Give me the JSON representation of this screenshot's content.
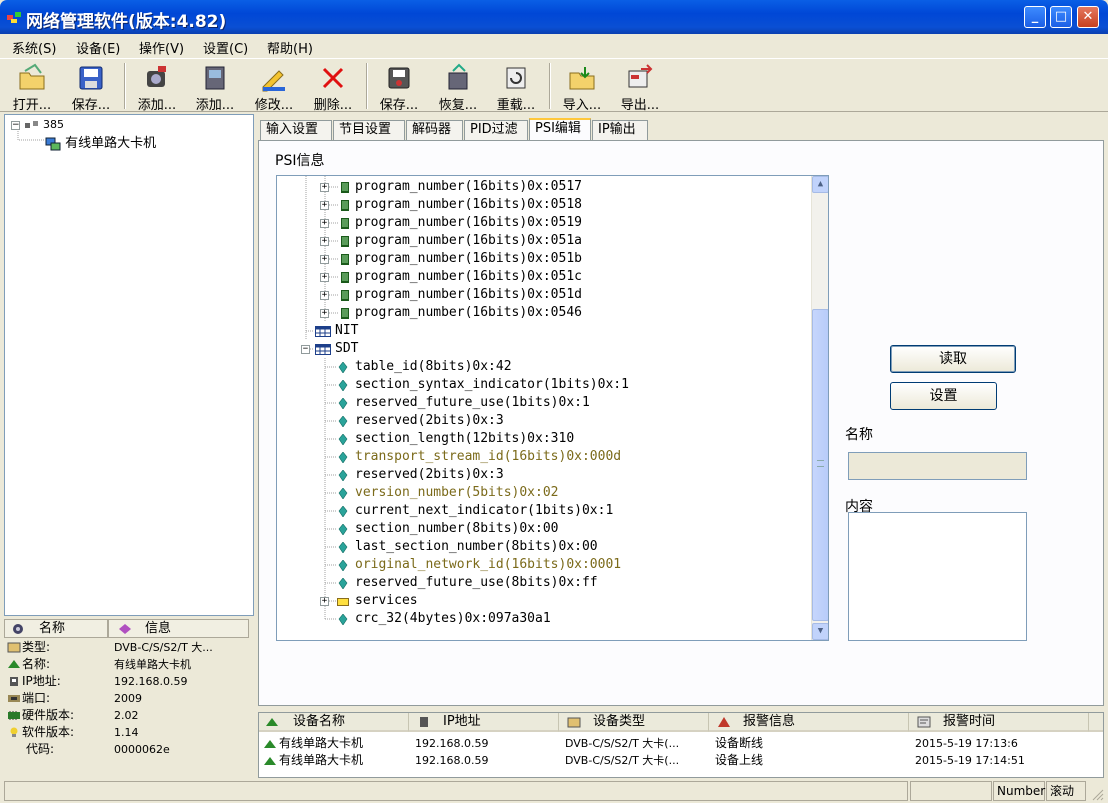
{
  "window": {
    "title": "网络管理软件(版本:4.82)",
    "minimize": "_",
    "maximize": "□",
    "close": "✕"
  },
  "menu": [
    {
      "label": "系统(S)"
    },
    {
      "label": "设备(E)"
    },
    {
      "label": "操作(V)"
    },
    {
      "label": "设置(C)"
    },
    {
      "label": "帮助(H)"
    }
  ],
  "toolbar": {
    "buttons": [
      {
        "label": "打开...",
        "icon": "open-folder-icon"
      },
      {
        "label": "保存...",
        "icon": "save-disk-icon"
      },
      {
        "label": "添加...",
        "icon": "add-camera-icon"
      },
      {
        "label": "添加...",
        "icon": "add-device-icon"
      },
      {
        "label": "修改...",
        "icon": "edit-icon"
      },
      {
        "label": "删除...",
        "icon": "delete-icon"
      },
      {
        "label": "保存...",
        "icon": "save-config-icon"
      },
      {
        "label": "恢复...",
        "icon": "restore-icon"
      },
      {
        "label": "重载...",
        "icon": "reload-icon"
      },
      {
        "label": "导入...",
        "icon": "import-icon"
      },
      {
        "label": "导出...",
        "icon": "export-icon"
      }
    ]
  },
  "device_tree": {
    "root": "385",
    "child": "有线单路大卡机"
  },
  "info_panel": {
    "headers": {
      "name": "名称",
      "info": "信息"
    },
    "rows": [
      {
        "key": "类型:",
        "value": "DVB-C/S/S2/T 大...",
        "icon": "type-icon"
      },
      {
        "key": "名称:",
        "value": "有线单路大卡机",
        "icon": "name-icon"
      },
      {
        "key": "IP地址:",
        "value": "192.168.0.59",
        "icon": "ip-icon"
      },
      {
        "key": "端口:",
        "value": "2009",
        "icon": "port-icon"
      },
      {
        "key": "硬件版本:",
        "value": "2.02",
        "icon": "hardware-icon"
      },
      {
        "key": "软件版本:",
        "value": "1.14",
        "icon": "software-icon"
      },
      {
        "key": "代码:",
        "value": "0000062e",
        "icon": ""
      }
    ]
  },
  "tabs": [
    {
      "label": "输入设置"
    },
    {
      "label": "节目设置"
    },
    {
      "label": "解码器"
    },
    {
      "label": "PID过滤"
    },
    {
      "label": "PSI编辑",
      "active": true
    },
    {
      "label": "IP输出"
    }
  ],
  "psi": {
    "section_label": "PSI信息",
    "tree": [
      {
        "text": "program_number(16bits)0x:0517",
        "kind": "program"
      },
      {
        "text": "program_number(16bits)0x:0518",
        "kind": "program"
      },
      {
        "text": "program_number(16bits)0x:0519",
        "kind": "program"
      },
      {
        "text": "program_number(16bits)0x:051a",
        "kind": "program"
      },
      {
        "text": "program_number(16bits)0x:051b",
        "kind": "program"
      },
      {
        "text": "program_number(16bits)0x:051c",
        "kind": "program"
      },
      {
        "text": "program_number(16bits)0x:051d",
        "kind": "program"
      },
      {
        "text": "program_number(16bits)0x:0546",
        "kind": "program"
      },
      {
        "text": "NIT",
        "kind": "table"
      },
      {
        "text": "SDT",
        "kind": "table-open"
      },
      {
        "text": "table_id(8bits)0x:42",
        "kind": "field"
      },
      {
        "text": "section_syntax_indicator(1bits)0x:1",
        "kind": "field"
      },
      {
        "text": "reserved_future_use(1bits)0x:1",
        "kind": "field"
      },
      {
        "text": "reserved(2bits)0x:3",
        "kind": "field"
      },
      {
        "text": "section_length(12bits)0x:310",
        "kind": "field"
      },
      {
        "text": "transport_stream_id(16bits)0x:000d",
        "kind": "field-editable"
      },
      {
        "text": "reserved(2bits)0x:3",
        "kind": "field"
      },
      {
        "text": "version_number(5bits)0x:02",
        "kind": "field-editable"
      },
      {
        "text": "current_next_indicator(1bits)0x:1",
        "kind": "field"
      },
      {
        "text": "section_number(8bits)0x:00",
        "kind": "field"
      },
      {
        "text": "last_section_number(8bits)0x:00",
        "kind": "field"
      },
      {
        "text": "original_network_id(16bits)0x:0001",
        "kind": "field-editable"
      },
      {
        "text": "reserved_future_use(8bits)0x:ff",
        "kind": "field"
      },
      {
        "text": "services",
        "kind": "folder"
      },
      {
        "text": "crc_32(4bytes)0x:097a30a1",
        "kind": "field"
      }
    ],
    "read_button": "读取",
    "set_button": "设置",
    "name_label": "名称",
    "name_value": "",
    "content_label": "内容",
    "content_value": ""
  },
  "alarm_list": {
    "headers": {
      "device_name": "设备名称",
      "ip": "IP地址",
      "device_type": "设备类型",
      "alarm_info": "报警信息",
      "alarm_time": "报警时间"
    },
    "rows": [
      {
        "device_name": "有线单路大卡机",
        "ip": "192.168.0.59",
        "device_type": "DVB-C/S/S2/T 大卡(...",
        "alarm_info": "设备断线",
        "alarm_time": "2015-5-19 17:13:6"
      },
      {
        "device_name": "有线单路大卡机",
        "ip": "192.168.0.59",
        "device_type": "DVB-C/S/S2/T 大卡(...",
        "alarm_info": "设备上线",
        "alarm_time": "2015-5-19 17:14:51"
      }
    ]
  },
  "statusbar": {
    "number": "Number",
    "scroll": "滚动"
  },
  "colors": {
    "titlebar": "#0a4fd4",
    "editable_field": "#7b6a1a",
    "window_bg": "#ece9d8"
  }
}
